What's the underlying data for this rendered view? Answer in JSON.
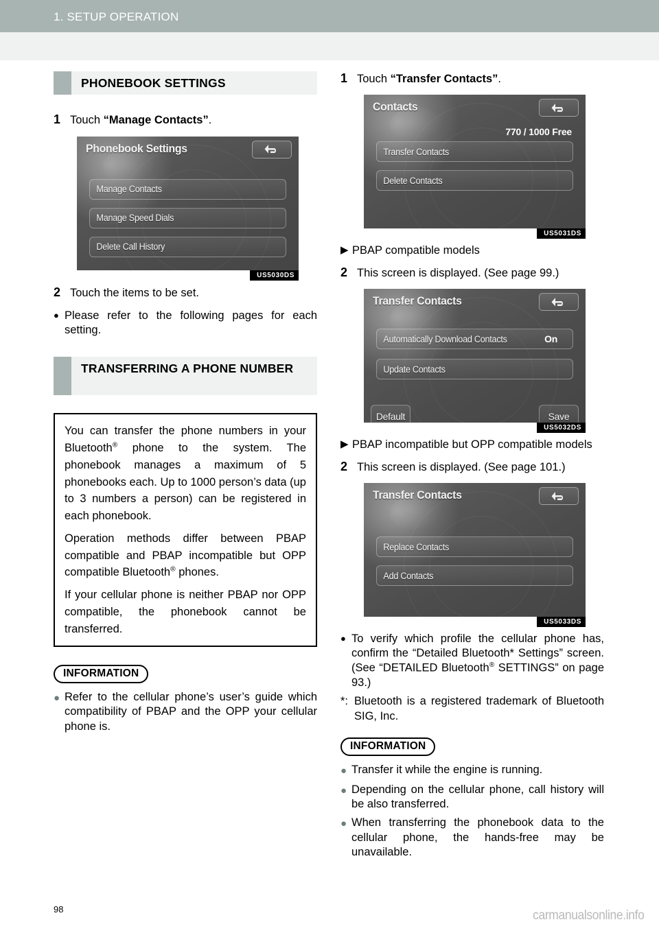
{
  "header": {
    "chapter_title": "1. SETUP OPERATION"
  },
  "left_column": {
    "section1_heading": "PHONEBOOK SETTINGS",
    "step1": {
      "num": "1",
      "prefix": "Touch ",
      "quoted": "“Manage Contacts”",
      "suffix": "."
    },
    "screen1": {
      "title": "Phonebook Settings",
      "buttons": [
        "Manage Contacts",
        "Manage Speed Dials",
        "Delete Call History"
      ],
      "back_icon": "back-arrow-icon",
      "code": "US5030DS"
    },
    "step2": {
      "num": "2",
      "text": "Touch the items to be set."
    },
    "bullet1": "Please refer to the following pages for each setting.",
    "section2_heading": "TRANSFERRING A PHONE NUMBER",
    "text_box": {
      "p1_a": "You can transfer the phone numbers in your Bluetooth",
      "p1_reg": "®",
      "p1_b": " phone to the system. The phonebook manages a maximum of 5 phonebooks each. Up to 1000 person’s data (up to 3 numbers a person) can be registered in each phonebook.",
      "p2_a": "Operation methods differ between PBAP compatible and PBAP incompatible but OPP compatible Bluetooth",
      "p2_reg": "®",
      "p2_b": " phones.",
      "p3": "If your cellular phone is neither PBAP nor OPP compatible, the phonebook cannot be transferred."
    },
    "information": {
      "label": "INFORMATION",
      "items": [
        "Refer to the cellular phone’s user’s guide which compatibility of PBAP and the OPP your cellular phone is."
      ]
    }
  },
  "right_column": {
    "step1": {
      "num": "1",
      "prefix": "Touch ",
      "quoted": "“Transfer Contacts”",
      "suffix": "."
    },
    "screen1": {
      "title": "Contacts",
      "free_text": "770 / 1000  Free",
      "buttons": [
        "Transfer Contacts",
        "Delete Contacts"
      ],
      "back_icon": "back-arrow-icon",
      "code": "US5031DS"
    },
    "marker1": "PBAP compatible models",
    "step2": {
      "num": "2",
      "text": "This screen is displayed. (See page 99.)"
    },
    "screen2": {
      "title": "Transfer Contacts",
      "row1_label": "Automatically Download Contacts",
      "row1_value": "On",
      "row2_label": "Update Contacts",
      "default_label": "Default",
      "save_label": "Save",
      "back_icon": "back-arrow-icon",
      "code": "US5032DS"
    },
    "marker2": "PBAP incompatible but OPP compatible models",
    "step3": {
      "num": "2",
      "text": "This screen is displayed. (See page 101.)"
    },
    "screen3": {
      "title": "Transfer Contacts",
      "buttons": [
        "Replace Contacts",
        "Add Contacts"
      ],
      "back_icon": "back-arrow-icon",
      "code": "US5033DS"
    },
    "bullet_verify_a": "To verify which profile the cellular phone has, confirm the “Detailed Bluetooth* Settings” screen. (See “DETAILED Bluetooth",
    "bullet_verify_reg": "®",
    "bullet_verify_b": " SETTINGS” on page 93.)",
    "footnote": {
      "mark": "*:",
      "text": "Bluetooth is a registered trademark of Bluetooth SIG, Inc."
    },
    "information": {
      "label": "INFORMATION",
      "items": [
        "Transfer it while the engine is running.",
        "Depending on the cellular phone, call history will be also transferred.",
        "When transferring the phonebook data to the cellular phone, the hands-free may be unavailable."
      ]
    }
  },
  "footer": {
    "page_number": "98",
    "watermark": "carmanualsonline.info"
  },
  "colors": {
    "header_bar": "#a8b4b2",
    "header_band": "#f0f1f1",
    "accent_swatch": "#a8b4b2",
    "section_bg": "#f0f1f1",
    "bullet_gray": "#6b7d7c"
  }
}
